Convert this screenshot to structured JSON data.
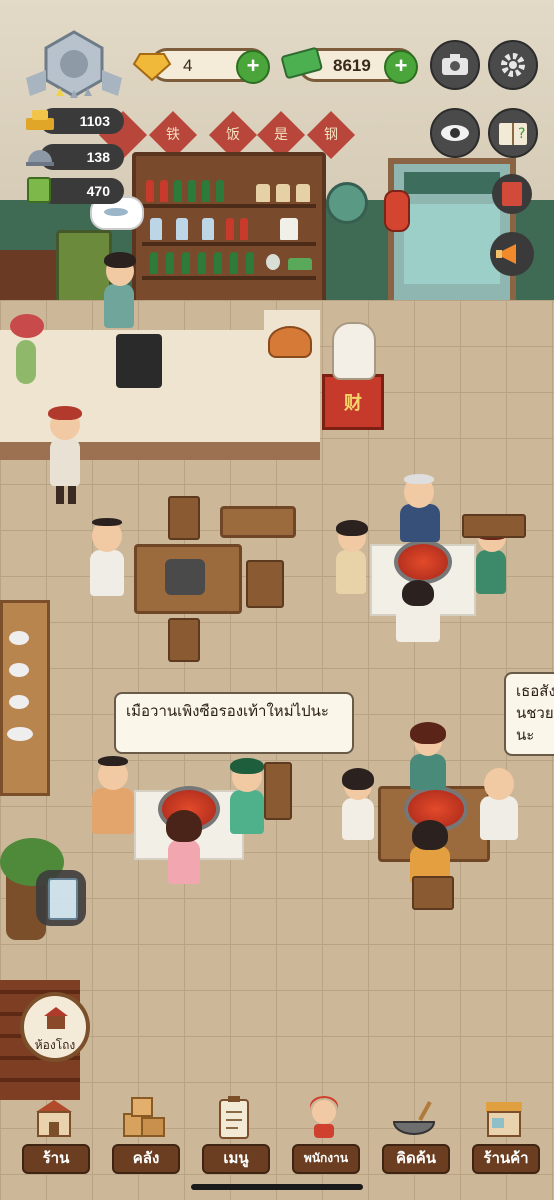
{
  "hud": {
    "gems": "4",
    "cash": "8619",
    "stats": [
      {
        "icon": "gold-ingot-icon",
        "value": "1103"
      },
      {
        "icon": "cloche-icon",
        "value": "138"
      },
      {
        "icon": "book-icon",
        "value": "470"
      }
    ]
  },
  "wall_signs": [
    "铁",
    "饭",
    "是",
    "钢"
  ],
  "lucky_cat_label": "财",
  "dialogue": {
    "left": "เมือวานเพิงซือรองเท้าใหม่ไปนะ",
    "right": "เธอสังฉันชวยวนะ"
  },
  "side_button": {
    "label": "ห้องโถง"
  },
  "bottom_nav": [
    {
      "id": "shop",
      "label": "ร้าน",
      "icon": "shop-icon"
    },
    {
      "id": "storage",
      "label": "คลัง",
      "icon": "boxes-icon"
    },
    {
      "id": "menu",
      "label": "เมนู",
      "icon": "clipboard-icon"
    },
    {
      "id": "staff",
      "label": "พนักงาน",
      "icon": "waitress-icon"
    },
    {
      "id": "research",
      "label": "คิดค้น",
      "icon": "wok-icon"
    },
    {
      "id": "store",
      "label": "ร้านค้า",
      "icon": "store-awning-icon"
    }
  ]
}
